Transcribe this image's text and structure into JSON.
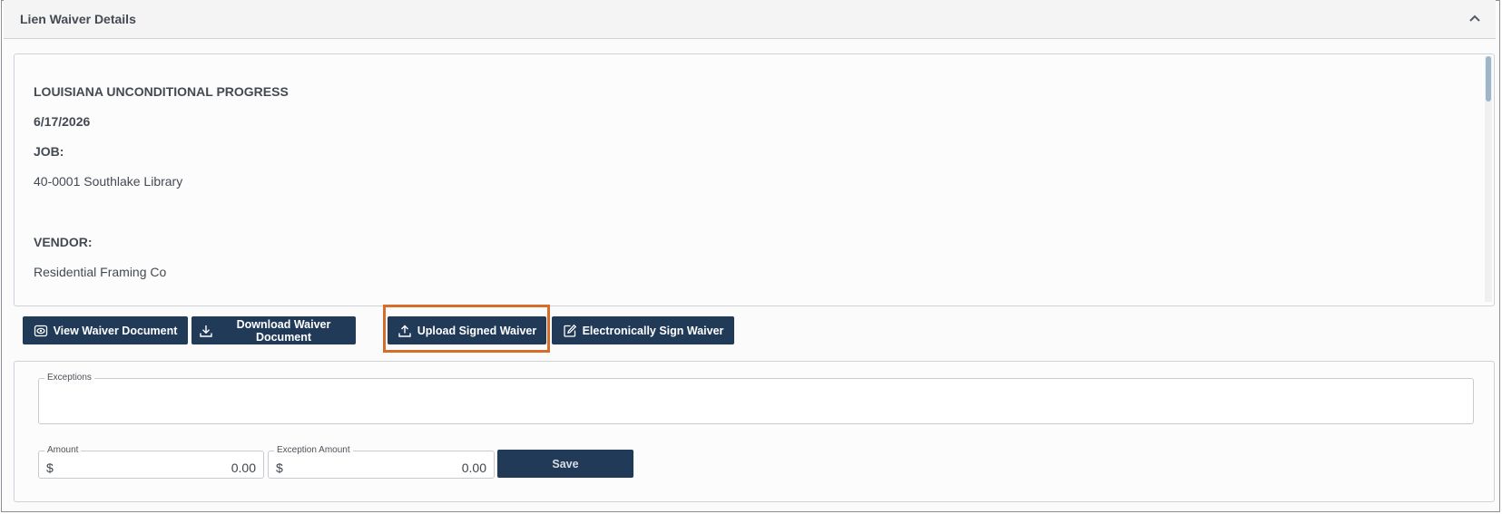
{
  "panel": {
    "title": "Lien Waiver Details"
  },
  "document": {
    "heading": "LOUISIANA UNCONDITIONAL PROGRESS",
    "date": "6/17/2026",
    "job_label": "JOB:",
    "job_value": "40-0001 Southlake Library",
    "vendor_label": "VENDOR:",
    "vendor_value": "Residential Framing Co"
  },
  "actions": {
    "view": "View Waiver Document",
    "download": "Download Waiver Document",
    "upload": "Upload Signed Waiver",
    "esign": "Electronically Sign Waiver"
  },
  "form": {
    "exceptions_label": "Exceptions",
    "exceptions_value": "",
    "amount_label": "Amount",
    "amount_currency": "$",
    "amount_value": "0.00",
    "exception_amount_label": "Exception Amount",
    "exception_amount_currency": "$",
    "exception_amount_value": "0.00",
    "save_label": "Save"
  },
  "icons": {
    "collapse": "chevron-up-icon",
    "view": "eye-icon",
    "download": "download-icon",
    "upload": "upload-icon",
    "esign": "edit-icon"
  },
  "colors": {
    "button_bg": "#203a58",
    "highlight": "#d56e2b"
  }
}
